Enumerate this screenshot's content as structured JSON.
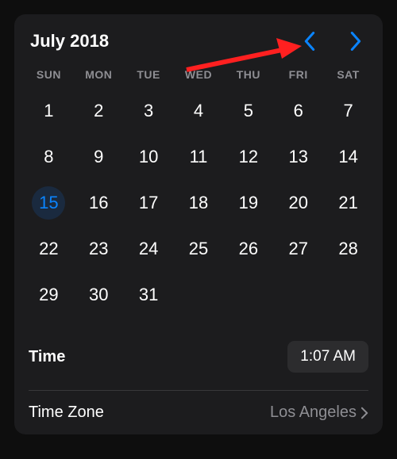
{
  "month_label": "July 2018",
  "weekdays": [
    "SUN",
    "MON",
    "TUE",
    "WED",
    "THU",
    "FRI",
    "SAT"
  ],
  "days": [
    1,
    2,
    3,
    4,
    5,
    6,
    7,
    8,
    9,
    10,
    11,
    12,
    13,
    14,
    15,
    16,
    17,
    18,
    19,
    20,
    21,
    22,
    23,
    24,
    25,
    26,
    27,
    28,
    29,
    30,
    31
  ],
  "selected_day": 15,
  "time_label": "Time",
  "time_value": "1:07 AM",
  "tz_label": "Time Zone",
  "tz_value": "Los Angeles"
}
